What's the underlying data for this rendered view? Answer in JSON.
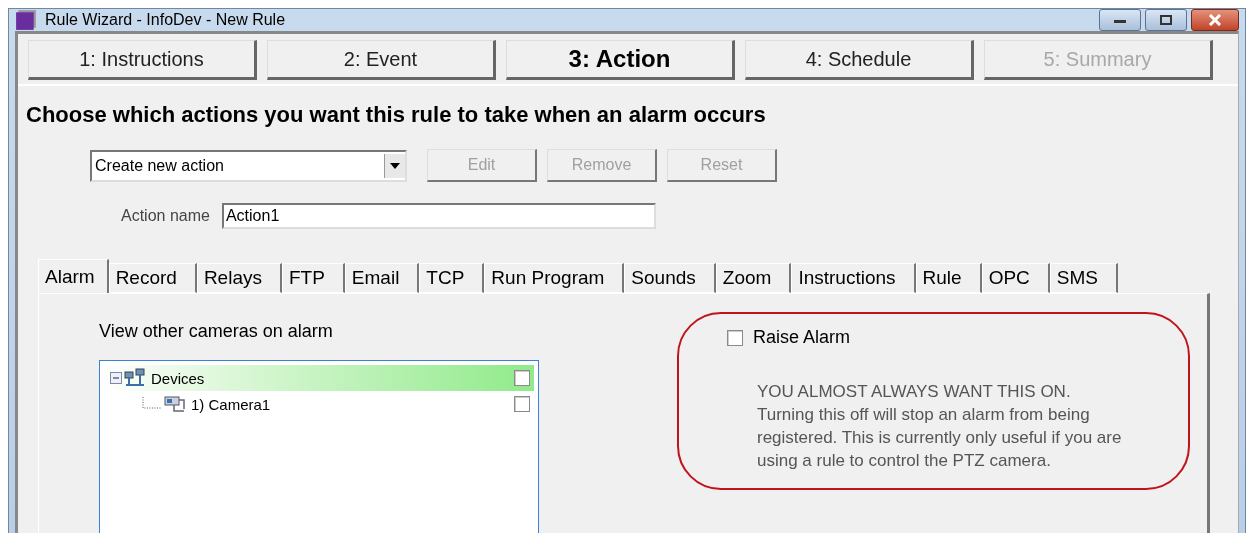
{
  "window": {
    "title": "Rule Wizard - InfoDev - New Rule"
  },
  "steps": [
    {
      "label": "1: Instructions",
      "selected": false,
      "disabled": false
    },
    {
      "label": "2: Event",
      "selected": false,
      "disabled": false
    },
    {
      "label": "3: Action",
      "selected": true,
      "disabled": false
    },
    {
      "label": "4: Schedule",
      "selected": false,
      "disabled": false
    },
    {
      "label": "5: Summary",
      "selected": false,
      "disabled": true
    }
  ],
  "heading": "Choose which actions you want this rule to take when an alarm occurs",
  "action_select": {
    "value": "Create new action"
  },
  "action_buttons": [
    {
      "label": "Edit",
      "disabled": true
    },
    {
      "label": "Remove",
      "disabled": true
    },
    {
      "label": "Reset",
      "disabled": true
    }
  ],
  "action_name": {
    "label": "Action name",
    "value": "Action1"
  },
  "tabs": [
    {
      "label": "Alarm",
      "selected": true
    },
    {
      "label": "Record",
      "selected": false
    },
    {
      "label": "Relays",
      "selected": false
    },
    {
      "label": "FTP",
      "selected": false
    },
    {
      "label": "Email",
      "selected": false
    },
    {
      "label": "TCP",
      "selected": false
    },
    {
      "label": "Run Program",
      "selected": false
    },
    {
      "label": "Sounds",
      "selected": false
    },
    {
      "label": "Zoom",
      "selected": false
    },
    {
      "label": "Instructions",
      "selected": false
    },
    {
      "label": "Rule",
      "selected": false
    },
    {
      "label": "OPC",
      "selected": false
    },
    {
      "label": "SMS",
      "selected": false
    }
  ],
  "cameras": {
    "label": "View other cameras on alarm",
    "tree": [
      {
        "label": "Devices",
        "selected": true,
        "checked": false,
        "expanded": true,
        "children": [
          {
            "label": "1) Camera1",
            "selected": false,
            "checked": false
          }
        ]
      }
    ]
  },
  "raise_alarm": {
    "label": "Raise Alarm",
    "checked": false
  },
  "note": {
    "title": "YOU ALMOST ALWAYS WANT THIS ON.",
    "body": "Turning this off will stop an alarm from being registered.  This is currently only useful if you are using a rule to control the PTZ camera."
  }
}
